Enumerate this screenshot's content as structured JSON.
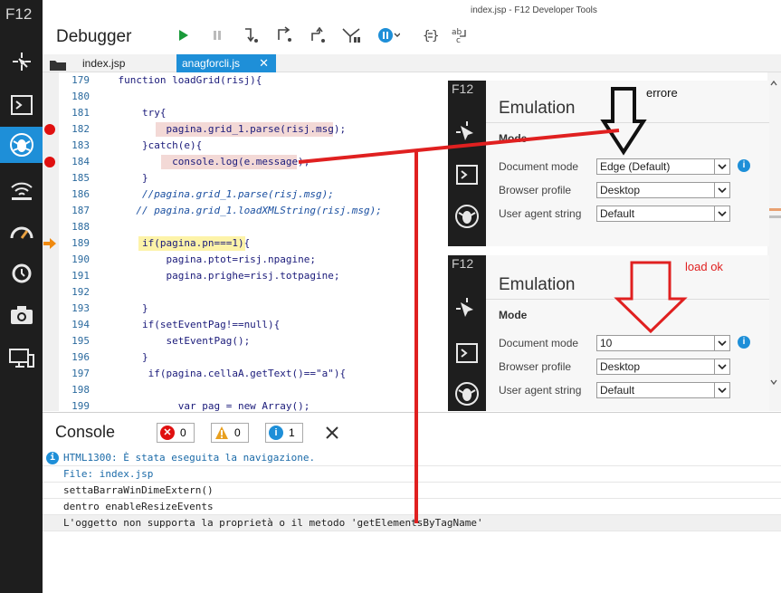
{
  "window_title": "index.jsp - F12 Developer Tools",
  "f12_label": "F12",
  "left_tools": [
    {
      "name": "dom-explorer-icon"
    },
    {
      "name": "console-icon"
    },
    {
      "name": "debugger-icon"
    },
    {
      "name": "network-icon"
    },
    {
      "name": "performance-icon"
    },
    {
      "name": "memory-icon"
    },
    {
      "name": "camera-icon"
    },
    {
      "name": "emulation-icon"
    }
  ],
  "debugger": {
    "title": "Debugger",
    "toolbar": [
      "continue-icon",
      "pause-icon",
      "step-into-icon",
      "step-over-icon",
      "step-out-icon",
      "break-on-new-worker-icon",
      "exception-behavior-icon",
      "pretty-print-icon",
      "word-wrap-icon"
    ]
  },
  "tabs": [
    {
      "label": "index.jsp"
    },
    {
      "label": "anagforcli.js"
    }
  ],
  "code_lines": [
    {
      "n": "179",
      "text": "    function loadGrid(risj){"
    },
    {
      "n": "180",
      "text": ""
    },
    {
      "n": "181",
      "text": "        try{"
    },
    {
      "n": "182",
      "text": "            pagina.grid_1.parse(risj.msg);"
    },
    {
      "n": "183",
      "text": "        }catch(e){"
    },
    {
      "n": "184",
      "text": "             console.log(e.message);"
    },
    {
      "n": "185",
      "text": "        }"
    },
    {
      "n": "186",
      "text": "        //pagina.grid_1.parse(risj.msg);"
    },
    {
      "n": "187",
      "text": "       // pagina.grid_1.loadXMLString(risj.msg);"
    },
    {
      "n": "188",
      "text": ""
    },
    {
      "n": "189",
      "text": "        if(pagina.pn===1){"
    },
    {
      "n": "190",
      "text": "            pagina.ptot=risj.npagine;"
    },
    {
      "n": "191",
      "text": "            pagina.prighe=risj.totpagine;"
    },
    {
      "n": "192",
      "text": ""
    },
    {
      "n": "193",
      "text": "        }"
    },
    {
      "n": "194",
      "text": "        if(setEventPag!==null){"
    },
    {
      "n": "195",
      "text": "            setEventPag();"
    },
    {
      "n": "196",
      "text": "        }"
    },
    {
      "n": "197",
      "text": "         if(pagina.cellaA.getText()==\"a\"){"
    },
    {
      "n": "198",
      "text": ""
    },
    {
      "n": "199",
      "text": "              var pag = new Array();"
    }
  ],
  "console": {
    "title": "Console",
    "errors": "0",
    "warnings": "0",
    "infos": "1",
    "lines": [
      "HTML1300: È stata eseguita la navigazione.",
      "File: index.jsp",
      "settaBarraWinDimeExtern()",
      "dentro enableResizeEvents",
      "L'oggetto non supporta la proprietà o il metodo 'getElementsByTagName'"
    ]
  },
  "emulation_top": {
    "f12": "F12",
    "title": "Emulation",
    "mode": "Mode",
    "doc_mode_label": "Document mode",
    "doc_mode_value": "Edge (Default)",
    "browser_profile_label": "Browser profile",
    "browser_profile_value": "Desktop",
    "ua_label": "User agent string",
    "ua_value": "Default"
  },
  "emulation_bottom": {
    "f12": "F12",
    "title": "Emulation",
    "mode": "Mode",
    "doc_mode_label": "Document mode",
    "doc_mode_value": "10",
    "browser_profile_label": "Browser profile",
    "browser_profile_value": "Desktop",
    "ua_label": "User agent string",
    "ua_value": "Default"
  },
  "annotations": {
    "errore": "errore",
    "load_ok": "load ok"
  },
  "colors": {
    "accent": "#1e8fd8",
    "breakpoint": "#e01010",
    "annotation_red": "#e02020",
    "dark_bar": "#1e1e1e"
  }
}
